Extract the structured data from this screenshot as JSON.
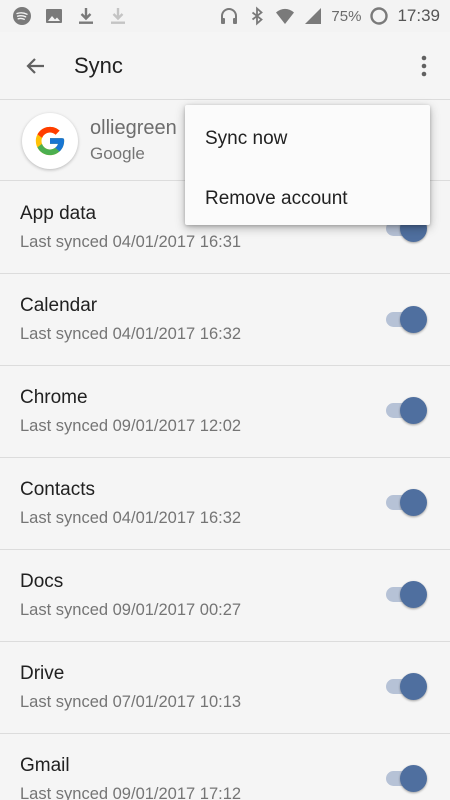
{
  "status_bar": {
    "icons_left": [
      "spotify-icon",
      "image-icon",
      "download-icon",
      "download-faded-icon"
    ],
    "icons_right": [
      "headphones-icon",
      "bluetooth-icon",
      "wifi-icon",
      "signal-icon"
    ],
    "battery": "75%",
    "time": "17:39"
  },
  "app_bar": {
    "title": "Sync",
    "back_icon": "arrow-back-icon",
    "overflow_icon": "more-vert-icon"
  },
  "account": {
    "name": "olliegreen",
    "type": "Google",
    "logo_icon": "google-g-icon"
  },
  "sync_items": [
    {
      "title": "App data",
      "subtitle": "Last synced 04/01/2017 16:31",
      "enabled": true
    },
    {
      "title": "Calendar",
      "subtitle": "Last synced 04/01/2017 16:32",
      "enabled": true
    },
    {
      "title": "Chrome",
      "subtitle": "Last synced 09/01/2017 12:02",
      "enabled": true
    },
    {
      "title": "Contacts",
      "subtitle": "Last synced 04/01/2017 16:32",
      "enabled": true
    },
    {
      "title": "Docs",
      "subtitle": "Last synced 09/01/2017 00:27",
      "enabled": true
    },
    {
      "title": "Drive",
      "subtitle": "Last synced 07/01/2017 10:13",
      "enabled": true
    },
    {
      "title": "Gmail",
      "subtitle": "Last synced 09/01/2017 17:12",
      "enabled": true
    }
  ],
  "menu": {
    "items": [
      "Sync now",
      "Remove account"
    ]
  },
  "colors": {
    "toggle_on": "#4f6f9f",
    "toggle_track": "#b6c2d6",
    "background": "#f5f5f5"
  }
}
